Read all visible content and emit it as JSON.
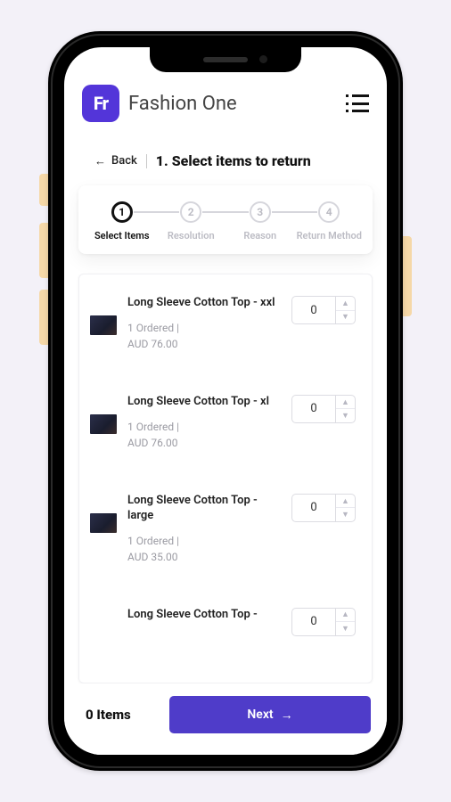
{
  "app": {
    "logo_text": "Fr",
    "title": "Fashion One"
  },
  "nav": {
    "back_label": "Back",
    "page_title": "1. Select items to return"
  },
  "stepper": {
    "steps": [
      {
        "num": "1",
        "label": "Select Items",
        "active": true
      },
      {
        "num": "2",
        "label": "Resolution",
        "active": false
      },
      {
        "num": "3",
        "label": "Reason",
        "active": false
      },
      {
        "num": "4",
        "label": "Return Method",
        "active": false
      }
    ]
  },
  "items": [
    {
      "name": "Long Sleeve Cotton Top - xxl",
      "ordered": "1 Ordered",
      "price": "AUD 76.00",
      "qty": "0"
    },
    {
      "name": "Long Sleeve Cotton Top - xl",
      "ordered": "1 Ordered",
      "price": "AUD 76.00",
      "qty": "0"
    },
    {
      "name": "Long Sleeve Cotton Top - large",
      "ordered": "1 Ordered",
      "price": "AUD 35.00",
      "qty": "0"
    },
    {
      "name": "Long Sleeve Cotton Top -",
      "ordered": "",
      "price": "",
      "qty": "0"
    }
  ],
  "footer": {
    "count_label": "0 Items",
    "next_label": "Next"
  },
  "meta_sep": "  |"
}
